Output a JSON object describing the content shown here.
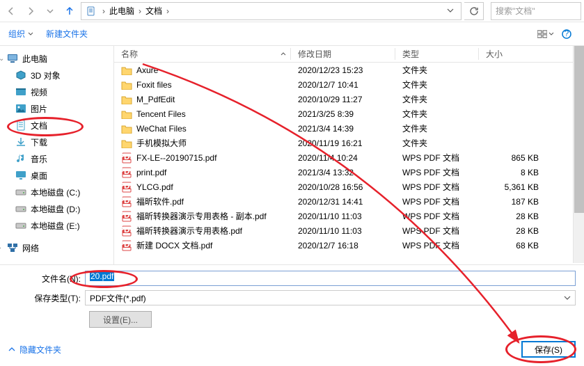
{
  "path": {
    "crumbs": [
      "此电脑",
      "文档"
    ]
  },
  "search": {
    "placeholder": "搜索\"文档\""
  },
  "commandBar": {
    "organize": "组织",
    "newFolder": "新建文件夹"
  },
  "sidebar": {
    "root": {
      "label": "此电脑"
    },
    "items": [
      {
        "label": "3D 对象",
        "icon": "3d"
      },
      {
        "label": "视频",
        "icon": "video"
      },
      {
        "label": "图片",
        "icon": "picture"
      },
      {
        "label": "文档",
        "icon": "doc",
        "selected": true
      },
      {
        "label": "下载",
        "icon": "download"
      },
      {
        "label": "音乐",
        "icon": "music"
      },
      {
        "label": "桌面",
        "icon": "desktop"
      },
      {
        "label": "本地磁盘 (C:)",
        "icon": "drive"
      },
      {
        "label": "本地磁盘 (D:)",
        "icon": "drive"
      },
      {
        "label": "本地磁盘 (E:)",
        "icon": "drive"
      }
    ],
    "network": {
      "label": "网络"
    }
  },
  "columns": {
    "name": "名称",
    "date": "修改日期",
    "type": "类型",
    "size": "大小"
  },
  "files": [
    {
      "name": "Axure",
      "date": "2020/12/23 15:23",
      "type": "文件夹",
      "size": "",
      "icon": "folder"
    },
    {
      "name": "Foxit files",
      "date": "2020/12/7 10:41",
      "type": "文件夹",
      "size": "",
      "icon": "folder"
    },
    {
      "name": "M_PdfEdit",
      "date": "2020/10/29 11:27",
      "type": "文件夹",
      "size": "",
      "icon": "folder"
    },
    {
      "name": "Tencent Files",
      "date": "2021/3/25 8:39",
      "type": "文件夹",
      "size": "",
      "icon": "folder"
    },
    {
      "name": "WeChat Files",
      "date": "2021/3/4 14:39",
      "type": "文件夹",
      "size": "",
      "icon": "folder"
    },
    {
      "name": "手机模拟大师",
      "date": "2020/11/19 16:21",
      "type": "文件夹",
      "size": "",
      "icon": "folder"
    },
    {
      "name": "FX-LE--20190715.pdf",
      "date": "2020/11/4 10:24",
      "type": "WPS PDF 文档",
      "size": "865 KB",
      "icon": "pdf"
    },
    {
      "name": "print.pdf",
      "date": "2021/3/4 13:32",
      "type": "WPS PDF 文档",
      "size": "8 KB",
      "icon": "pdf"
    },
    {
      "name": "YLCG.pdf",
      "date": "2020/10/28 16:56",
      "type": "WPS PDF 文档",
      "size": "5,361 KB",
      "icon": "pdf"
    },
    {
      "name": "福昕软件.pdf",
      "date": "2020/12/31 14:41",
      "type": "WPS PDF 文档",
      "size": "187 KB",
      "icon": "pdf"
    },
    {
      "name": "福昕转换器演示专用表格 - 副本.pdf",
      "date": "2020/11/10 11:03",
      "type": "WPS PDF 文档",
      "size": "28 KB",
      "icon": "pdf"
    },
    {
      "name": "福昕转换器演示专用表格.pdf",
      "date": "2020/11/10 11:03",
      "type": "WPS PDF 文档",
      "size": "28 KB",
      "icon": "pdf"
    },
    {
      "name": "新建 DOCX 文档.pdf",
      "date": "2020/12/7 16:18",
      "type": "WPS PDF 文档",
      "size": "68 KB",
      "icon": "pdf"
    }
  ],
  "filenameField": {
    "label": "文件名(N):",
    "value": "20.pdf"
  },
  "filetypeField": {
    "label": "保存类型(T):",
    "value": "PDF文件(*.pdf)"
  },
  "settingsBtn": "设置(E)...",
  "hideFolders": "隐藏文件夹",
  "saveBtn": "保存(S)"
}
